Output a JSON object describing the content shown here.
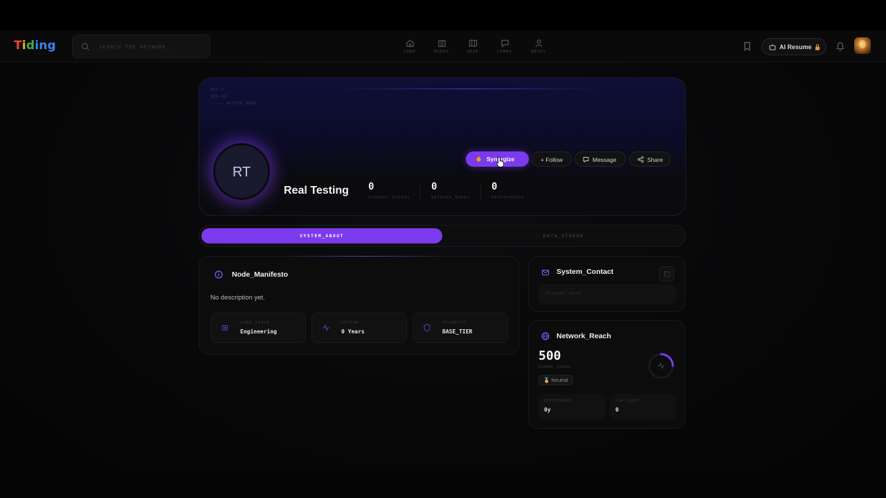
{
  "brand": {
    "letters": [
      "T",
      "i",
      "d",
      "i",
      "n",
      "g"
    ]
  },
  "search": {
    "placeholder": "SEARCH THE NETWORK..."
  },
  "nav": [
    {
      "label": "CORE",
      "icon": "home-icon"
    },
    {
      "label": "NODES",
      "icon": "building-icon"
    },
    {
      "label": "GRID",
      "icon": "map-icon"
    },
    {
      "label": "COMMS",
      "icon": "chat-icon"
    },
    {
      "label": "NEXUS",
      "icon": "users-icon"
    }
  ],
  "header": {
    "ai_resume": "AI Resume"
  },
  "hero": {
    "code_lines": [
      "SEC-1",
      "SEC-02",
      "-----  ACTIVE NODE"
    ],
    "initials": "RT",
    "name": "Real Testing",
    "stats": [
      {
        "value": "0",
        "label": "SYNERGY_POINTS"
      },
      {
        "value": "0",
        "label": "NETWORK_NODES"
      },
      {
        "value": "0",
        "label": "DEPLOYMENTS"
      }
    ],
    "buttons": {
      "synergize": "Synergize",
      "follow": "+ Follow",
      "message": "Message",
      "share": "Share"
    }
  },
  "tabs": {
    "about": "SYSTEM_ABOUT",
    "stream": "DATA_STREAM"
  },
  "manifesto": {
    "title": "Node_Manifesto",
    "description": "No description yet.",
    "attributes": [
      {
        "label": "CORE_STACK",
        "value": "Engineering",
        "icon": "chip-icon"
      },
      {
        "label": "UPTIME",
        "value": "0 Years",
        "icon": "pulse-icon"
      },
      {
        "label": "SECURITY",
        "value": "BASE_TIER",
        "icon": "shield-icon"
      }
    ]
  },
  "contact": {
    "title": "System_Contact",
    "primary_label": "PRIMARY NODE"
  },
  "reach": {
    "title": "Network_Reach",
    "karma_value": "500",
    "karma_label": "KARMA_INDEX",
    "badge": "🏅 Neutral",
    "gauge_fraction": 0.25,
    "mini": [
      {
        "label": "EXPERIENCE",
        "value": "0y"
      },
      {
        "label": "POW COUNT",
        "value": "0"
      }
    ]
  },
  "colors": {
    "accent": "#7c3aed",
    "background": "#060606"
  }
}
